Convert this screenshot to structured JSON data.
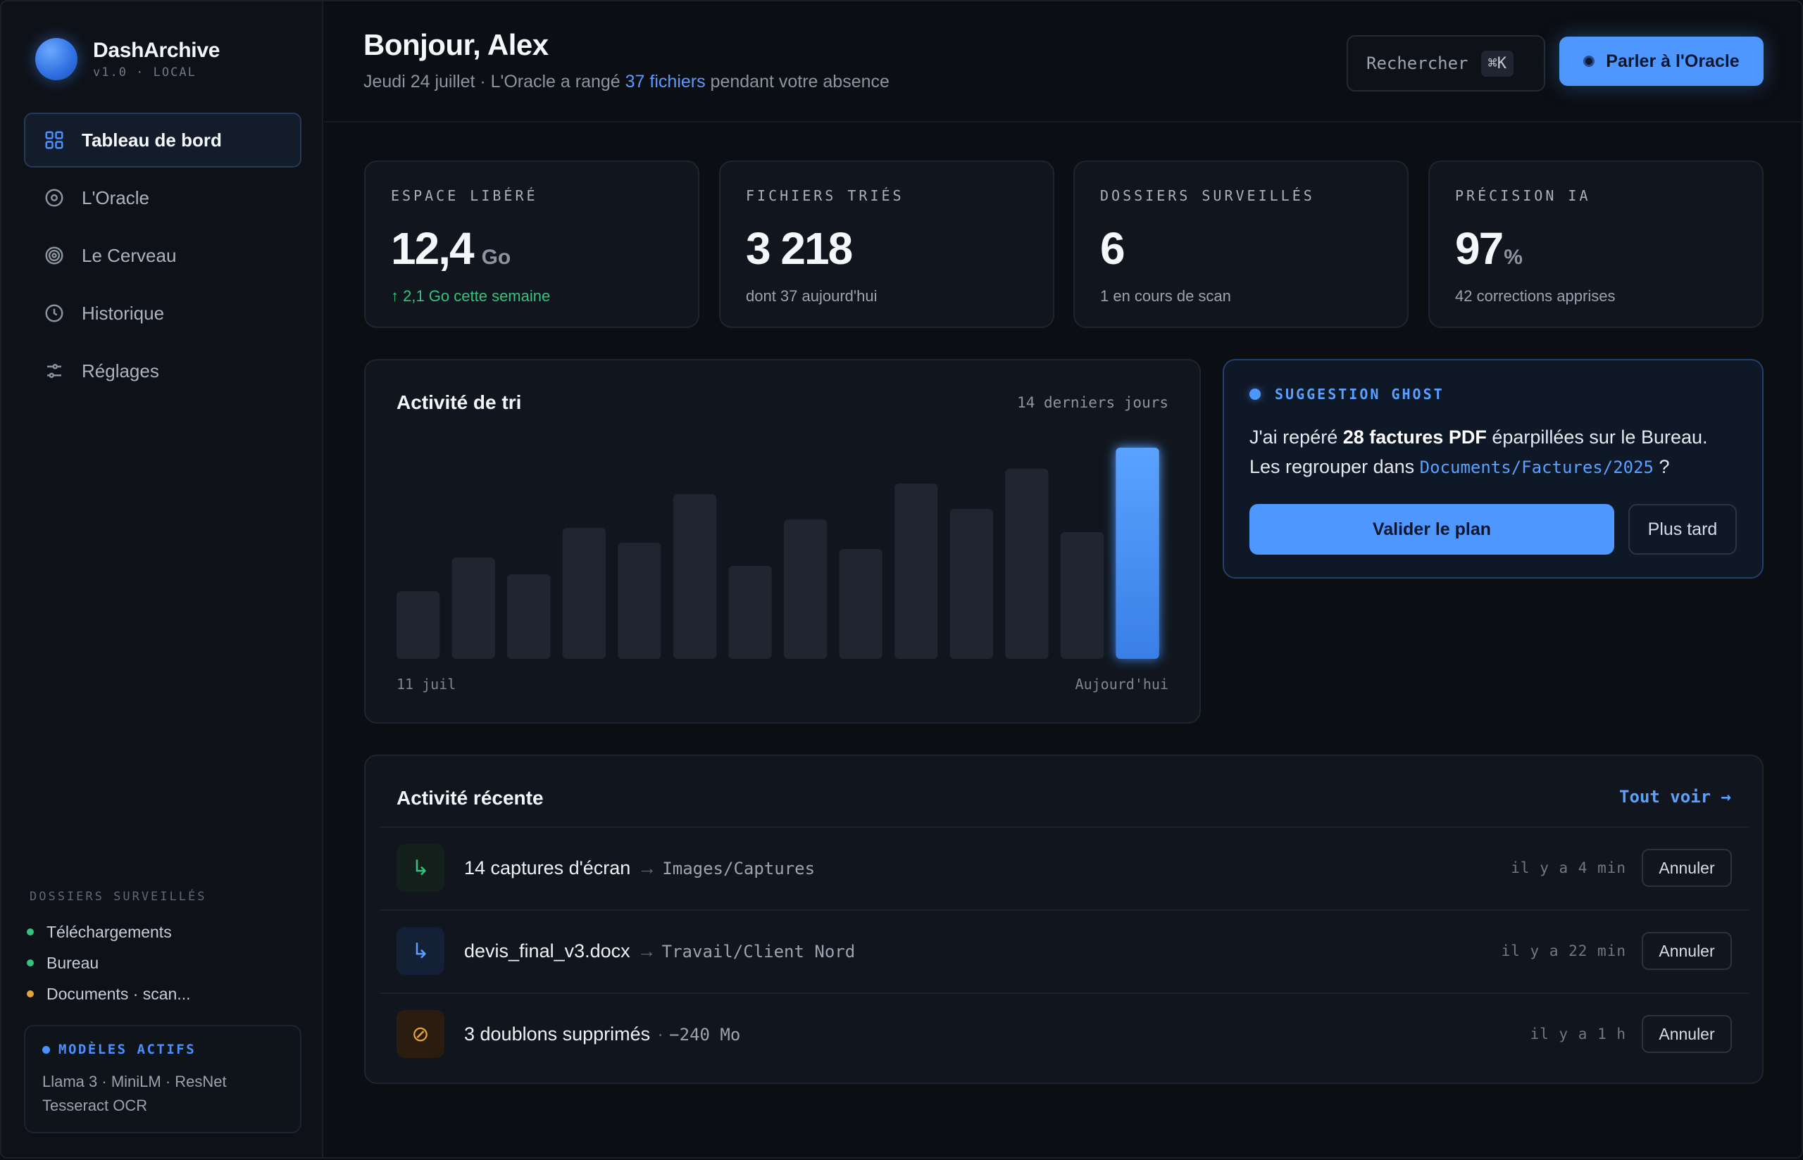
{
  "brand": {
    "name": "DashArchive",
    "sub": "v1.0 · LOCAL"
  },
  "nav": [
    {
      "label": "Tableau de bord",
      "icon": "grid-icon",
      "active": true
    },
    {
      "label": "L'Oracle",
      "icon": "target-icon"
    },
    {
      "label": "Le Cerveau",
      "icon": "concentric-circles-icon"
    },
    {
      "label": "Historique",
      "icon": "clock-icon"
    },
    {
      "label": "Réglages",
      "icon": "sliders-icon"
    }
  ],
  "watched": {
    "title": "DOSSIERS SURVEILLÉS",
    "items": [
      {
        "label": "Téléchargements",
        "color": "#35c27a"
      },
      {
        "label": "Bureau",
        "color": "#35c27a"
      },
      {
        "label": "Documents · scan...",
        "color": "#e6a23c"
      }
    ]
  },
  "models": {
    "title": "MODÈLES ACTIFS",
    "line1": "Llama 3 · MiniLM · ResNet",
    "line2": "Tesseract OCR"
  },
  "header": {
    "greeting": "Bonjour, Alex",
    "sub_prefix": "Jeudi 24 juillet · L'Oracle a rangé ",
    "sub_highlight": "37 fichiers",
    "sub_suffix": " pendant votre absence",
    "search_label": "Rechercher",
    "search_kbd": "⌘K",
    "oracle_button": "Parler à l'Oracle"
  },
  "stats": [
    {
      "label": "ESPACE LIBÉRÉ",
      "value": "12,4",
      "unit": "Go",
      "note": "↑ 2,1 Go cette semaine",
      "note_color": "green"
    },
    {
      "label": "FICHIERS TRIÉS",
      "value": "3 218",
      "unit": "",
      "note": "dont 37 aujourd'hui"
    },
    {
      "label": "DOSSIERS SURVEILLÉS",
      "value": "6",
      "unit": "",
      "note": "1 en cours de scan"
    },
    {
      "label": "PRÉCISION IA",
      "value": "97",
      "unit": "%",
      "note": "42 corrections apprises"
    }
  ],
  "chart_data": {
    "type": "bar",
    "title": "Activité de tri",
    "range_label": "14 derniers jours",
    "x_start_label": "11 juil",
    "x_end_label": "Aujourd'hui",
    "values": [
      32,
      48,
      40,
      62,
      55,
      78,
      44,
      66,
      52,
      83,
      71,
      90,
      60,
      100
    ],
    "ylim": [
      0,
      100
    ],
    "highlight_last": true,
    "colors": {
      "bar": "#1f2631",
      "highlight": "#4d97ff"
    }
  },
  "ghost": {
    "title": "SUGGESTION GHOST",
    "text_a": "J'ai repéré ",
    "text_bold": "28 factures PDF",
    "text_b": " éparpillées sur le Bureau. Les regrouper dans ",
    "path": "Documents/Factures/2025",
    "text_c": " ?",
    "ok": "Valider le plan",
    "later": "Plus tard"
  },
  "recent": {
    "title": "Activité récente",
    "see_all": "Tout voir →",
    "rows": [
      {
        "icon": "arrow-down-right-icon",
        "glyph": "↳",
        "icon_color": "#35c27a",
        "icon_bg": "#14201c",
        "title": "14 captures d'écran",
        "sep": "→",
        "detail": "Images/Captures",
        "time": "il y a 4 min",
        "undo": "Annuler"
      },
      {
        "icon": "arrow-down-right-icon",
        "glyph": "↳",
        "icon_color": "#5aa0ff",
        "icon_bg": "#132036",
        "title": "devis_final_v3.docx",
        "sep": "→",
        "detail": "Travail/Client Nord",
        "time": "il y a 22 min",
        "undo": "Annuler"
      },
      {
        "icon": "slash-circle-icon",
        "glyph": "⊘",
        "icon_color": "#e6a23c",
        "icon_bg": "#2a1d10",
        "title": "3 doublons supprimés",
        "sep": "·",
        "detail": "−240 Mo",
        "time": "il y a 1 h",
        "undo": "Annuler"
      }
    ]
  }
}
